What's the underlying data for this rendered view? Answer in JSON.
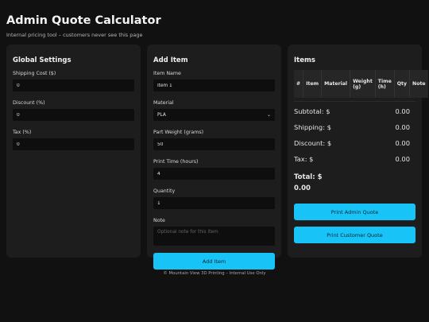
{
  "header": {
    "title": "Admin Quote Calculator",
    "subtitle": "Internal pricing tool – customers never see this page"
  },
  "global_settings": {
    "title": "Global Settings",
    "shipping_label": "Shipping Cost ($)",
    "shipping_value": "0",
    "discount_label": "Discount (%)",
    "discount_value": "0",
    "tax_label": "Tax (%)",
    "tax_value": "0"
  },
  "add_item": {
    "title": "Add Item",
    "item_name_label": "Item Name",
    "item_name_value": "Item 1",
    "material_label": "Material",
    "material_value": "PLA",
    "weight_label": "Part Weight (grams)",
    "weight_value": "50",
    "print_time_label": "Print Time (hours)",
    "print_time_value": "4",
    "quantity_label": "Quantity",
    "quantity_value": "1",
    "note_label": "Note",
    "note_placeholder": "Optional note for this item",
    "add_button": "Add Item"
  },
  "items": {
    "title": "Items",
    "columns": [
      "#",
      "Item",
      "Material",
      "Weight (g)",
      "Time (h)",
      "Qty",
      "Note"
    ],
    "subtotal_label": "Subtotal: $",
    "subtotal_value": "0.00",
    "shipping_label": "Shipping: $",
    "shipping_value": "0.00",
    "discount_label": "Discount: $",
    "discount_value": "0.00",
    "tax_label": "Tax: $",
    "tax_value": "0.00",
    "total_label": "Total: $",
    "total_value": "0.00",
    "print_admin_button": "Print Admin Quote",
    "print_customer_button": "Print Customer Quote"
  },
  "footer": "© Mountain View 3D Printing – Internal Use Only",
  "colors": {
    "background": "#111111",
    "card": "#1d1d1d",
    "accent": "#18c3f7"
  }
}
